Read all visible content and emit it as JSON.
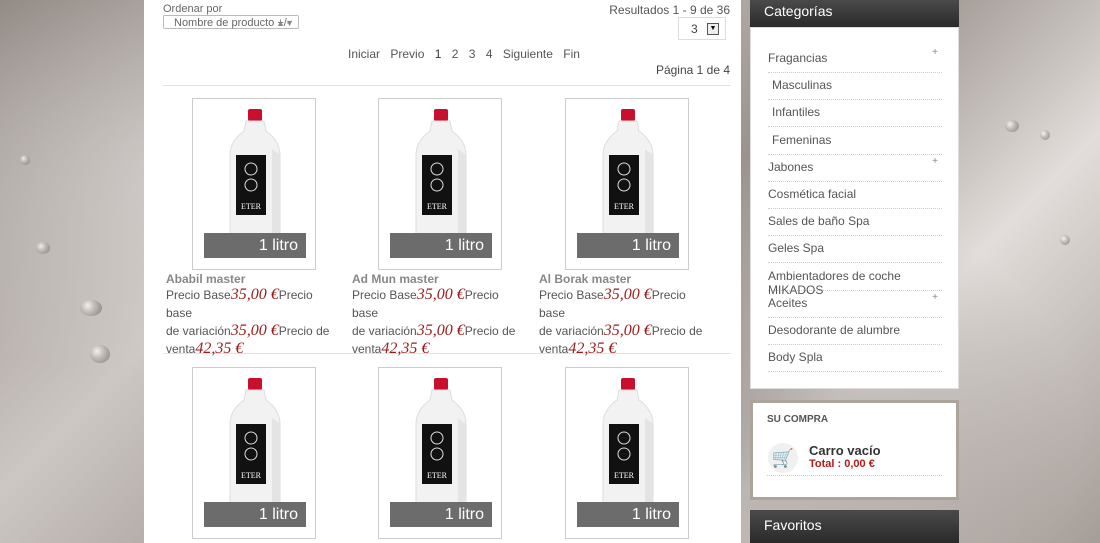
{
  "toolbar": {
    "sort_label": "Ordenar por",
    "sort_value": "Nombre de producto +/-",
    "results": "Resultados 1 - 9 de 36",
    "per_page": "3",
    "page_of": "Página 1 de 4"
  },
  "pager": {
    "first": "Iniciar",
    "prev": "Previo",
    "pages": [
      "1",
      "2",
      "3",
      "4"
    ],
    "next": "Siguiente",
    "last": "Fin"
  },
  "products": [
    {
      "name": "Ababil master",
      "label": "1 litro",
      "price_base_label": "Precio Base",
      "price_base": "35,00 €",
      "price_var_label_a": "Precio base",
      "price_var_label_b": "de variación",
      "price_var": "35,00 €",
      "price_sale_label_a": "Precio de",
      "price_sale_label_b": "venta",
      "price_sale": "42,35 €"
    },
    {
      "name": "Ad Mun master",
      "label": "1 litro",
      "price_base_label": "Precio Base",
      "price_base": "35,00 €",
      "price_var_label_a": "Precio base",
      "price_var_label_b": "de variación",
      "price_var": "35,00 €",
      "price_sale_label_a": "Precio de",
      "price_sale_label_b": "venta",
      "price_sale": "42,35 €"
    },
    {
      "name": "Al Borak master",
      "label": "1 litro",
      "price_base_label": "Precio Base",
      "price_base": "35,00 €",
      "price_var_label_a": "Precio base",
      "price_var_label_b": "de variación",
      "price_var": "35,00 €",
      "price_sale_label_a": "Precio de",
      "price_sale_label_b": "venta",
      "price_sale": "42,35 €"
    },
    {
      "label": "1 litro"
    },
    {
      "label": "1 litro"
    },
    {
      "label": "1 litro"
    }
  ],
  "bottle_brand": "ETER",
  "sidebar": {
    "categories_title": "Categorías",
    "categories": [
      {
        "label": "Fragancias",
        "expand": "+"
      },
      {
        "label": "Masculinas"
      },
      {
        "label": "Infantiles"
      },
      {
        "label": "Femeninas"
      },
      {
        "label": "Jabones",
        "expand": "+"
      },
      {
        "label": "Cosmética facial"
      },
      {
        "label": "Sales de baño Spa"
      },
      {
        "label": "Geles Spa"
      },
      {
        "label": "Ambientadores de coche MIKADOS"
      },
      {
        "label": "Aceites",
        "expand": "+"
      },
      {
        "label": "Desodorante de alumbre"
      },
      {
        "label": "Body Spla"
      }
    ],
    "cart_title": "SU COMPRA",
    "cart_empty": "Carro vacío",
    "cart_total": "Total : 0,00 €",
    "favorites_title": "Favoritos"
  },
  "colors": {
    "price": "#9b1b1b",
    "header_bg": "#333333",
    "cart_total": "#b31c1c"
  }
}
